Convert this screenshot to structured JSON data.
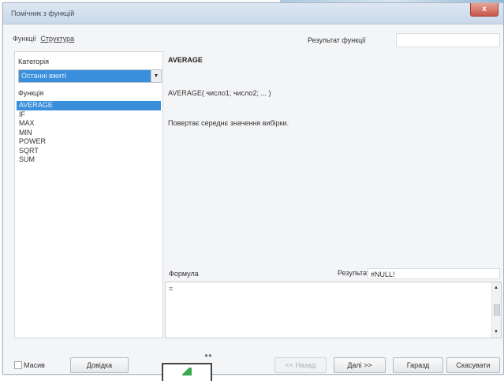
{
  "window": {
    "title": "Помічник з функцій",
    "close_label": "x"
  },
  "tabs": [
    {
      "label": "Функції",
      "active": false
    },
    {
      "label": "Структура",
      "active": true
    }
  ],
  "result_function": {
    "label": "Результат функції",
    "value": ""
  },
  "category": {
    "label": "Категорія",
    "selected": "Останні вжиті"
  },
  "functions": {
    "label": "Функція",
    "items": [
      "AVERAGE",
      "IF",
      "MAX",
      "MIN",
      "POWER",
      "SQRT",
      "SUM"
    ],
    "selected_index": 0
  },
  "details": {
    "name": "AVERAGE",
    "syntax": "AVERAGE( число1; число2; ... )",
    "description": "Повертає середнє значення вибірки."
  },
  "formula": {
    "label": "Формула",
    "value": "=",
    "result_label": "Результат",
    "result_value": "#NULL!"
  },
  "footer": {
    "array_label": "Масив",
    "faint_label": "...",
    "buttons": {
      "help": "Довідка",
      "back": "<< Назад",
      "next": "Далі >>",
      "ok": "Гаразд",
      "cancel": "Скасувати"
    }
  },
  "colors": {
    "selection": "#3a8fdc",
    "dialog_bg": "#f4f5f7",
    "close": "#c9564a"
  },
  "icons": [
    "close-icon",
    "dropdown-arrow-icon",
    "scroll-up-icon",
    "scroll-down-icon",
    "grip-icon"
  ]
}
